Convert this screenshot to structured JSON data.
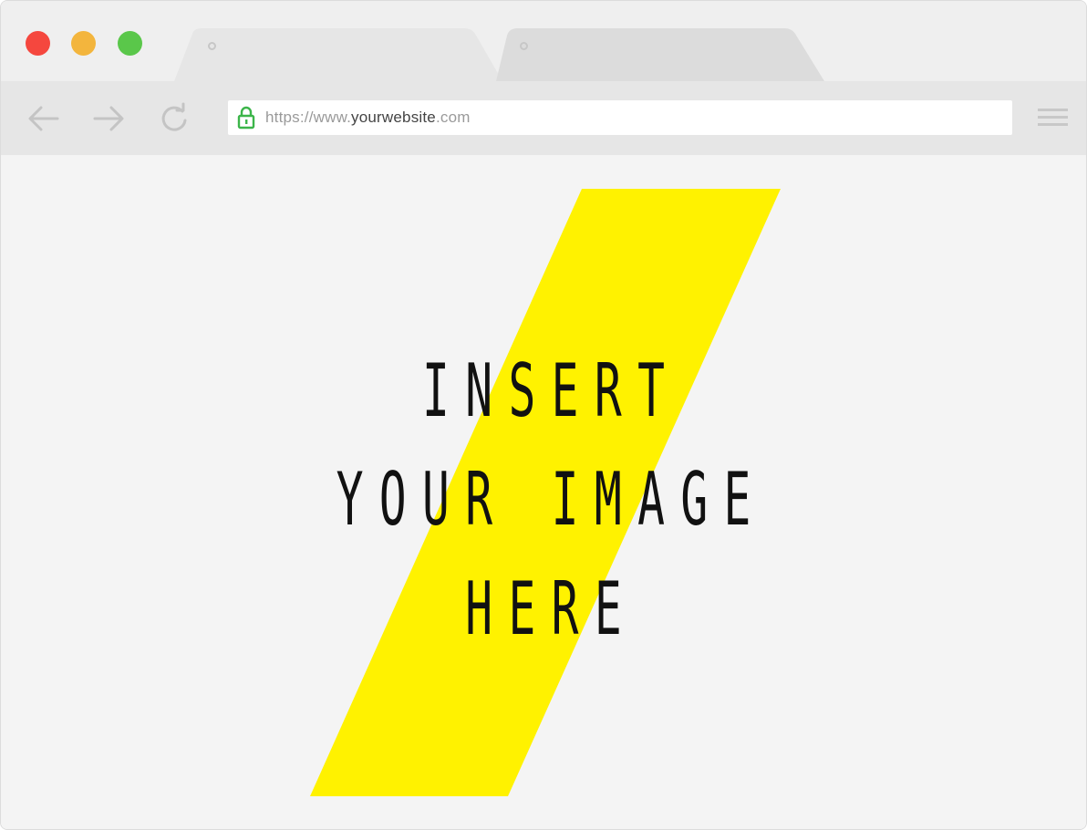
{
  "window": {
    "traffic_lights": [
      "close",
      "minimize",
      "maximize"
    ],
    "colors": {
      "close": "#f5473e",
      "minimize": "#f3b53d",
      "maximize": "#5ac74a"
    }
  },
  "tabs": [
    {
      "state": "active"
    },
    {
      "state": "inactive"
    }
  ],
  "toolbar": {
    "icons": [
      "arrow-left-icon",
      "arrow-right-icon",
      "reload-icon",
      "hamburger-menu-icon"
    ],
    "address": {
      "prefix": "https://www.",
      "domain": "yourwebsite",
      "suffix": ".com",
      "secure": true,
      "lock_color": "#3cb54a"
    }
  },
  "content": {
    "headline_lines": [
      "INSERT",
      "YOUR IMAGE",
      "HERE"
    ],
    "accent_color": "#fff200"
  }
}
